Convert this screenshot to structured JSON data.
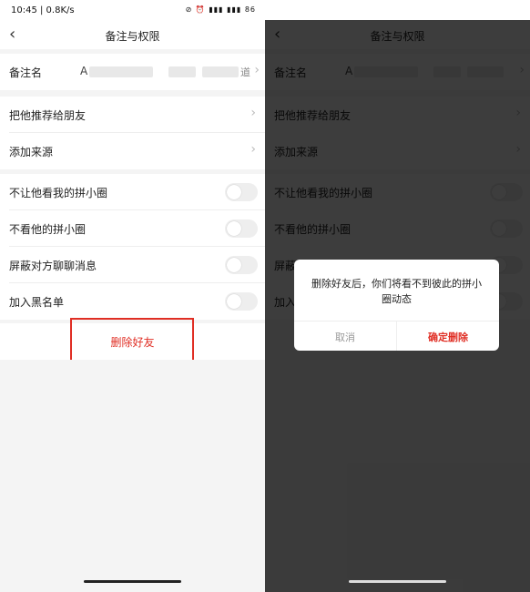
{
  "status": {
    "time": "10:45 | 0.8K/s",
    "icons": "⊘ ⏰  ▮▮▮ ▮▮▮ 86"
  },
  "header": {
    "title": "备注与权限"
  },
  "remark": {
    "label": "备注名",
    "value_prefix": "A",
    "value_suffix": "道"
  },
  "menu": [
    {
      "label": "把他推荐给朋友"
    },
    {
      "label": "添加来源"
    }
  ],
  "toggles": [
    {
      "label": "不让他看我的拼小圈",
      "state": "off"
    },
    {
      "label": "不看他的拼小圈",
      "state": "off"
    },
    {
      "label": "屏蔽对方聊聊消息",
      "state": "off"
    },
    {
      "label": "加入黑名单",
      "state": "off"
    }
  ],
  "delete": {
    "label": "删除好友"
  },
  "dialog": {
    "message": "删除好友后，你们将看不到彼此的拼小圈动态",
    "cancel": "取消",
    "confirm": "确定删除"
  },
  "colors": {
    "accent": "#e02e24",
    "overlay": "#3a3a3a"
  }
}
